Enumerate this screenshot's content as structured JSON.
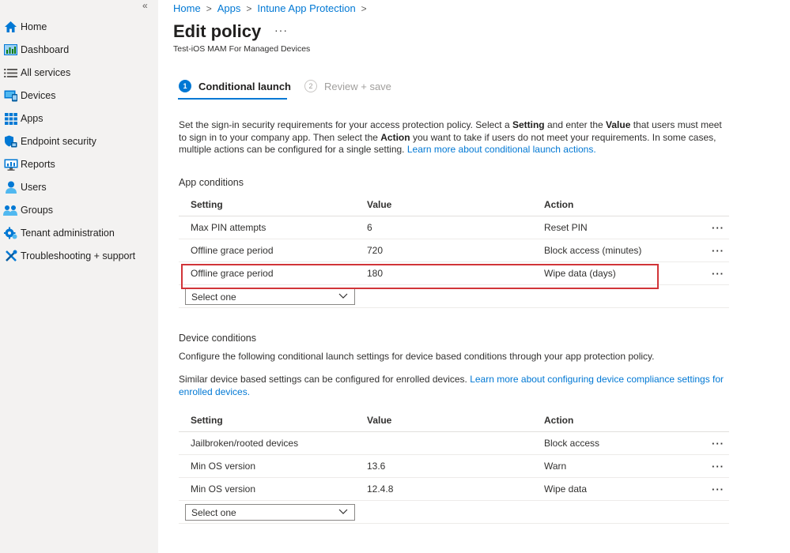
{
  "sidebar": {
    "collapse_glyph": "«",
    "items": [
      {
        "label": "Home",
        "icon": "home-icon"
      },
      {
        "label": "Dashboard",
        "icon": "dashboard-icon"
      },
      {
        "label": "All services",
        "icon": "all-services-icon"
      },
      {
        "label": "Devices",
        "icon": "devices-icon"
      },
      {
        "label": "Apps",
        "icon": "apps-icon"
      },
      {
        "label": "Endpoint security",
        "icon": "endpoint-security-icon"
      },
      {
        "label": "Reports",
        "icon": "reports-icon"
      },
      {
        "label": "Users",
        "icon": "users-icon"
      },
      {
        "label": "Groups",
        "icon": "groups-icon"
      },
      {
        "label": "Tenant administration",
        "icon": "tenant-administration-icon"
      },
      {
        "label": "Troubleshooting + support",
        "icon": "troubleshooting-icon"
      }
    ]
  },
  "breadcrumb": [
    "Home",
    "Apps",
    "Intune App Protection"
  ],
  "header": {
    "title": "Edit policy",
    "more": "···",
    "subtitle": "Test-iOS MAM For Managed Devices"
  },
  "steps": [
    {
      "num": "1",
      "label": "Conditional launch"
    },
    {
      "num": "2",
      "label": "Review + save"
    }
  ],
  "intro": {
    "p1": "Set the sign-in security requirements for your access protection policy. Select a ",
    "b1": "Setting",
    "p2": " and enter the ",
    "b2": "Value",
    "p3": " that users must meet to sign in to your company app. Then select the ",
    "b3": "Action",
    "p4": " you want to take if users do not meet your requirements. In some cases, multiple actions can be configured for a single setting. ",
    "link": "Learn more about conditional launch actions."
  },
  "app_conditions": {
    "title": "App conditions",
    "headers": [
      "Setting",
      "Value",
      "Action"
    ],
    "rows": [
      {
        "setting": "Max PIN attempts",
        "value": "6",
        "action": "Reset PIN"
      },
      {
        "setting": "Offline grace period",
        "value": "720",
        "action": "Block access (minutes)"
      },
      {
        "setting": "Offline grace period",
        "value": "180",
        "action": "Wipe data (days)"
      }
    ],
    "select_placeholder": "Select one"
  },
  "device_conditions": {
    "title": "Device conditions",
    "para1": "Configure the following conditional launch settings for device based conditions through your app protection policy.",
    "para2": "Similar device based settings can be configured for enrolled devices. ",
    "para2_link": "Learn more about configuring device compliance settings for enrolled devices.",
    "headers": [
      "Setting",
      "Value",
      "Action"
    ],
    "rows": [
      {
        "setting": "Jailbroken/rooted devices",
        "value": "",
        "action": "Block access"
      },
      {
        "setting": "Min OS version",
        "value": "13.6",
        "action": "Warn"
      },
      {
        "setting": "Min OS version",
        "value": "12.4.8",
        "action": "Wipe data"
      }
    ],
    "select_placeholder": "Select one"
  },
  "row_more": "···",
  "colors": {
    "accent": "#0078d4",
    "highlight": "#d13438",
    "sidebar_bg": "#f3f2f1"
  }
}
